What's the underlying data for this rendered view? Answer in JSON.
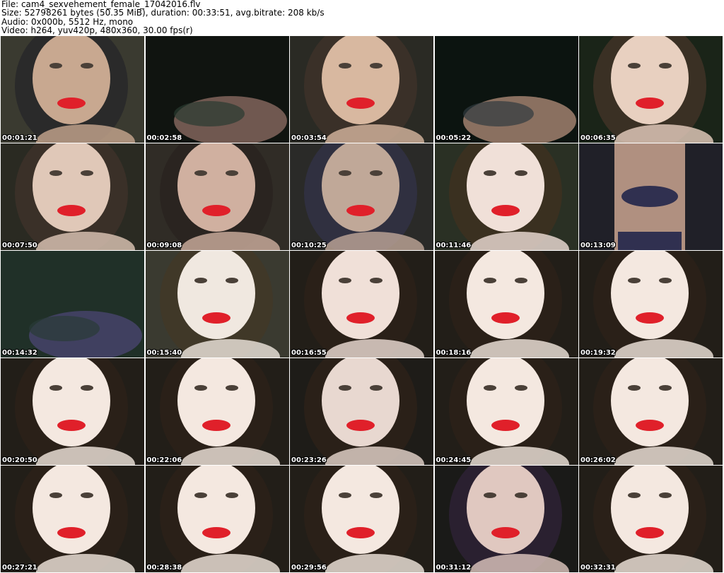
{
  "header": {
    "file_line": "File: cam4_sexvehement_female_17042016.flv",
    "size_line": "Size: 52798261 bytes (50.35 MiB), duration: 00:33:51, avg.bitrate: 208 kb/s",
    "audio_line": "Audio: 0x000b, 5512 Hz, mono",
    "video_line": "Video: h264, yuv420p, 480x360, 30.00 fps(r)"
  },
  "thumbnails": [
    {
      "time": "00:01:21",
      "palette": [
        "#3a3a30",
        "#c8a890",
        "#2a2a2a"
      ],
      "scene": "face"
    },
    {
      "time": "00:02:58",
      "palette": [
        "#101410",
        "#2a3a30",
        "#705850"
      ],
      "scene": "dark"
    },
    {
      "time": "00:03:54",
      "palette": [
        "#2a2a24",
        "#d8b8a0",
        "#3a3028"
      ],
      "scene": "face"
    },
    {
      "time": "00:05:22",
      "palette": [
        "#0c1410",
        "#303a40",
        "#8a7060"
      ],
      "scene": "dark"
    },
    {
      "time": "00:06:35",
      "palette": [
        "#1a2418",
        "#e8d0c0",
        "#3a3024"
      ],
      "scene": "face"
    },
    {
      "time": "00:07:50",
      "palette": [
        "#2a2a22",
        "#e0c8b8",
        "#3a3028"
      ],
      "scene": "face"
    },
    {
      "time": "00:09:08",
      "palette": [
        "#302c26",
        "#d0b0a0",
        "#2a2420"
      ],
      "scene": "face"
    },
    {
      "time": "00:10:25",
      "palette": [
        "#2a2a28",
        "#c0a898",
        "#303040"
      ],
      "scene": "face"
    },
    {
      "time": "00:11:46",
      "palette": [
        "#2a3024",
        "#f0e0d8",
        "#3a3020"
      ],
      "scene": "face"
    },
    {
      "time": "00:13:09",
      "palette": [
        "#202028",
        "#b09080",
        "#303050"
      ],
      "scene": "body"
    },
    {
      "time": "00:14:32",
      "palette": [
        "#203028",
        "#2a3a38",
        "#404060"
      ],
      "scene": "dark"
    },
    {
      "time": "00:15:40",
      "palette": [
        "#3a3a30",
        "#f0e8e0",
        "#403828"
      ],
      "scene": "face"
    },
    {
      "time": "00:16:55",
      "palette": [
        "#221e18",
        "#f0e0d8",
        "#2a2018"
      ],
      "scene": "face"
    },
    {
      "time": "00:18:16",
      "palette": [
        "#221e18",
        "#f4e8e0",
        "#2a2018"
      ],
      "scene": "face"
    },
    {
      "time": "00:19:32",
      "palette": [
        "#221e18",
        "#f4e8e0",
        "#2a2018"
      ],
      "scene": "face"
    },
    {
      "time": "00:20:50",
      "palette": [
        "#221e18",
        "#f4e8e0",
        "#2a2018"
      ],
      "scene": "face"
    },
    {
      "time": "00:22:06",
      "palette": [
        "#221e18",
        "#f4e8e0",
        "#2a2018"
      ],
      "scene": "face"
    },
    {
      "time": "00:23:26",
      "palette": [
        "#1e1c18",
        "#e8d8d0",
        "#2a2018"
      ],
      "scene": "face"
    },
    {
      "time": "00:24:45",
      "palette": [
        "#221e18",
        "#f4e8e0",
        "#2a2018"
      ],
      "scene": "face"
    },
    {
      "time": "00:26:02",
      "palette": [
        "#221e18",
        "#f4e8e0",
        "#2a2018"
      ],
      "scene": "face"
    },
    {
      "time": "00:27:21",
      "palette": [
        "#221e18",
        "#f4e8e0",
        "#2a2018"
      ],
      "scene": "face"
    },
    {
      "time": "00:28:38",
      "palette": [
        "#221e18",
        "#f4e8e0",
        "#2a2018"
      ],
      "scene": "face"
    },
    {
      "time": "00:29:56",
      "palette": [
        "#221e18",
        "#f4e8e0",
        "#2a2018"
      ],
      "scene": "face"
    },
    {
      "time": "00:31:12",
      "palette": [
        "#1a1a18",
        "#e0c8c0",
        "#2a2030"
      ],
      "scene": "face"
    },
    {
      "time": "00:32:31",
      "palette": [
        "#221e18",
        "#f4e8e0",
        "#2a2018"
      ],
      "scene": "face"
    }
  ],
  "colors": {
    "page_background": "#ffffff",
    "header_text": "#000000",
    "timestamp_text": "#ffffff",
    "lips": "#e0202a"
  }
}
